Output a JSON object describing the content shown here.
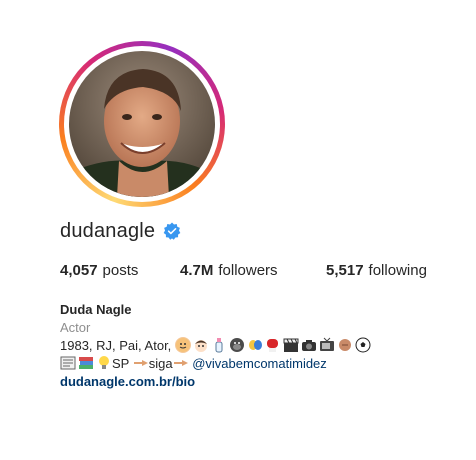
{
  "profile": {
    "username": "dudanagle",
    "verified_icon": "verified-badge-icon",
    "accent": "#3897f0"
  },
  "stats": {
    "posts_count": "4,057",
    "posts_label": "posts",
    "followers_count": "4.7M",
    "followers_label": "followers",
    "following_count": "5,517",
    "following_label": "following"
  },
  "bio": {
    "full_name": "Duda Nagle",
    "category": "Actor",
    "line1_text": "1983, RJ, Pai, Ator,",
    "line1_emojis": [
      "baby",
      "boy",
      "bottle",
      "gorilla",
      "masks",
      "boxing-glove",
      "clapper",
      "camera",
      "tv",
      "thumbs",
      "soccer-ball"
    ],
    "line2_emojis": [
      "newspaper",
      "books",
      "light-bulb"
    ],
    "line2_text_a": "SP",
    "line2_pointing": "pointing-hand",
    "line2_text_b": "siga",
    "line2_mention": "@vivabemcomatimidez",
    "website": "dudanagle.com.br/bio"
  }
}
